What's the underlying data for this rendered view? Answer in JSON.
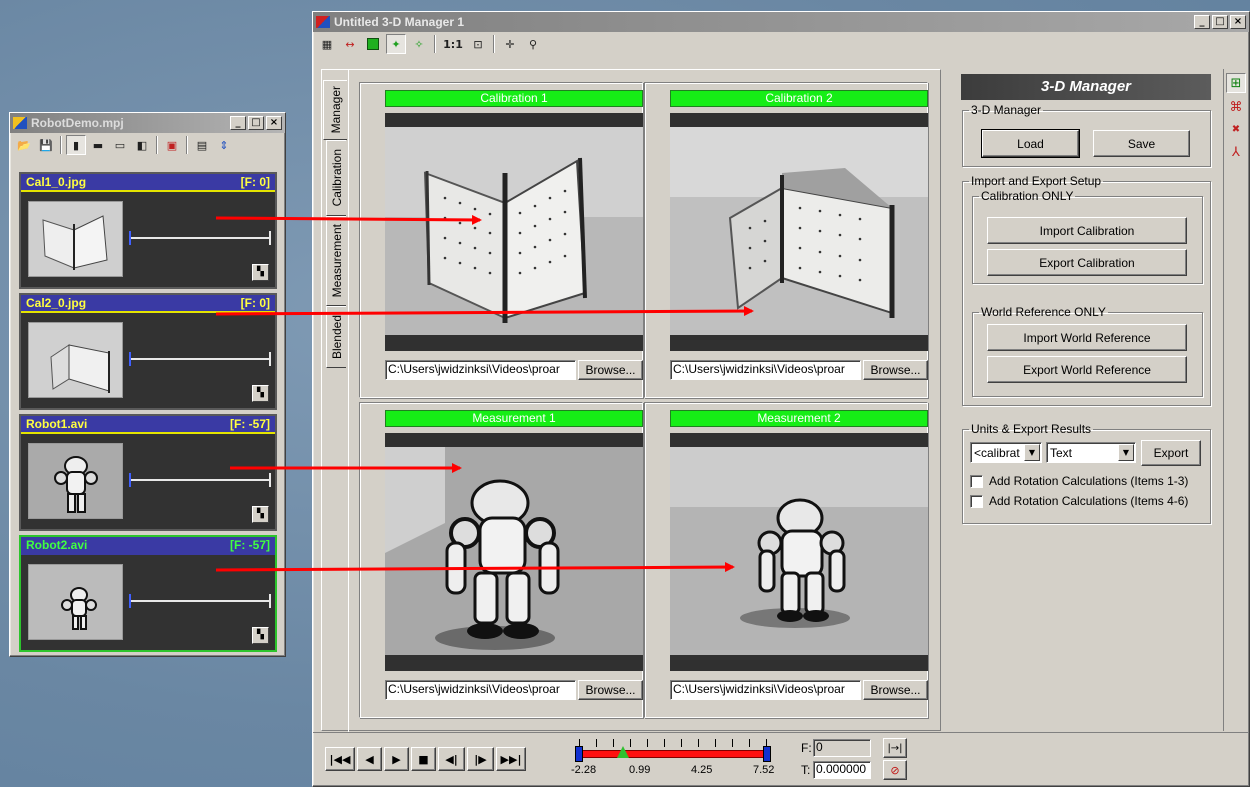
{
  "main_window": {
    "title": "Untitled 3-D Manager 1",
    "toolbar": [
      "grid-icon",
      "link-icon",
      "green-square-icon",
      "point-icon",
      "point-add-icon",
      "1:1",
      "fit-icon",
      "move-icon",
      "zoom-icon"
    ],
    "tabs": [
      "Manager",
      "Calibration",
      "Measurement",
      "Blended"
    ],
    "cells": [
      {
        "label": "Calibration 1",
        "path": "C:\\Users\\jwidzinksi\\Videos\\proar",
        "browse": "Browse..."
      },
      {
        "label": "Calibration 2",
        "path": "C:\\Users\\jwidzinksi\\Videos\\proar",
        "browse": "Browse..."
      },
      {
        "label": "Measurement 1",
        "path": "C:\\Users\\jwidzinksi\\Videos\\proar",
        "browse": "Browse..."
      },
      {
        "label": "Measurement 2",
        "path": "C:\\Users\\jwidzinksi\\Videos\\proar",
        "browse": "Browse..."
      }
    ],
    "right_panel": {
      "header": "3-D Manager",
      "manager_group": {
        "legend": "3-D Manager",
        "load": "Load",
        "save": "Save"
      },
      "import_export": {
        "legend": "Import and Export Setup",
        "calibration_group": {
          "legend": "Calibration ONLY",
          "import": "Import Calibration",
          "export": "Export Calibration"
        },
        "world_group": {
          "legend": "World Reference ONLY",
          "import": "Import World Reference",
          "export": "Export World Reference"
        }
      },
      "units_group": {
        "legend": "Units & Export Results",
        "units_value": "<calibrat",
        "format_value": "Text",
        "export": "Export",
        "rotation_1": "Add Rotation Calculations (Items 1-3)",
        "rotation_2": "Add Rotation Calculations (Items 4-6)"
      }
    },
    "side_toolbar": [
      "panel-grid-icon",
      "mesh-icon",
      "axis-x-icon",
      "axes-icon"
    ],
    "playback": {
      "ticks": [
        "-2.28",
        "0.99",
        "4.25",
        "7.52"
      ],
      "frame_label": "F:",
      "frame_value": "0",
      "time_label": "T:",
      "time_value": "0.000000",
      "start": -2.28,
      "end": 7.52,
      "current": 0.0
    }
  },
  "project_window": {
    "title": "RobotDemo.mpj",
    "items": [
      {
        "name": "Cal1_0.jpg",
        "frame": "[F: 0]"
      },
      {
        "name": "Cal2_0.jpg",
        "frame": "[F: 0]"
      },
      {
        "name": "Robot1.avi",
        "frame": "[F: -57]"
      },
      {
        "name": "Robot2.avi",
        "frame": "[F: -57]"
      }
    ]
  },
  "colors": {
    "accent_green": "#16ee16",
    "item_header": "#3a3aa4",
    "arrow_red": "#ff0000",
    "title_active": "#0a246a"
  }
}
